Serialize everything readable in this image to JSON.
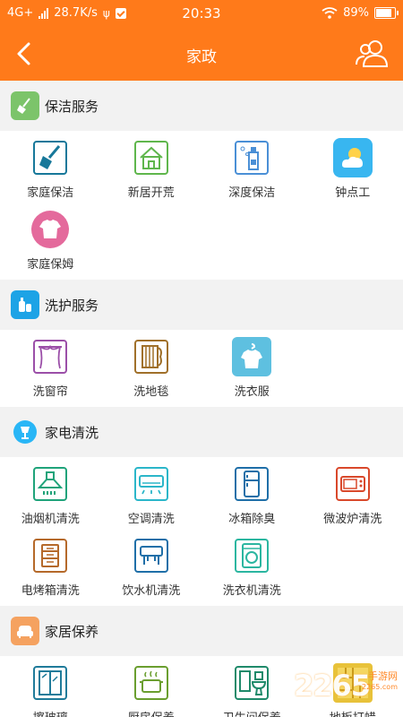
{
  "status": {
    "network": "4G+",
    "speed": "28.7K/s",
    "time": "20:33",
    "battery": "89%"
  },
  "header": {
    "title": "家政"
  },
  "colors": {
    "accent": "#ff7a1a"
  },
  "sections": [
    {
      "title": "保洁服务",
      "icon": "broom-icon",
      "items": [
        {
          "label": "家庭保洁",
          "icon": "broom-icon"
        },
        {
          "label": "新居开荒",
          "icon": "house-icon"
        },
        {
          "label": "深度保洁",
          "icon": "spray-bottle-icon"
        },
        {
          "label": "钟点工",
          "icon": "sun-cloud-icon"
        },
        {
          "label": "家庭保姆",
          "icon": "tshirt-icon"
        }
      ]
    },
    {
      "title": "洗护服务",
      "icon": "detergent-icon",
      "items": [
        {
          "label": "洗窗帘",
          "icon": "curtain-icon"
        },
        {
          "label": "洗地毯",
          "icon": "carpet-icon"
        },
        {
          "label": "洗衣服",
          "icon": "shirt-hanger-icon"
        }
      ]
    },
    {
      "title": "家电清洗",
      "icon": "lamp-icon",
      "items": [
        {
          "label": "油烟机清洗",
          "icon": "range-hood-icon"
        },
        {
          "label": "空调清洗",
          "icon": "air-conditioner-icon"
        },
        {
          "label": "冰箱除臭",
          "icon": "fridge-icon"
        },
        {
          "label": "微波炉清洗",
          "icon": "microwave-icon"
        },
        {
          "label": "电烤箱清洗",
          "icon": "oven-icon"
        },
        {
          "label": "饮水机清洗",
          "icon": "water-dispenser-icon"
        },
        {
          "label": "洗衣机清洗",
          "icon": "washing-machine-icon"
        }
      ]
    },
    {
      "title": "家居保养",
      "icon": "sofa-icon",
      "items": [
        {
          "label": "擦玻璃",
          "icon": "window-icon"
        },
        {
          "label": "厨房保养",
          "icon": "pot-icon"
        },
        {
          "label": "卫生间保养",
          "icon": "toilet-icon"
        },
        {
          "label": "地板打蜡",
          "icon": "floor-icon"
        }
      ]
    }
  ],
  "watermark": {
    "brand": "2265",
    "sub": "手游网",
    "url": "2265.com"
  }
}
